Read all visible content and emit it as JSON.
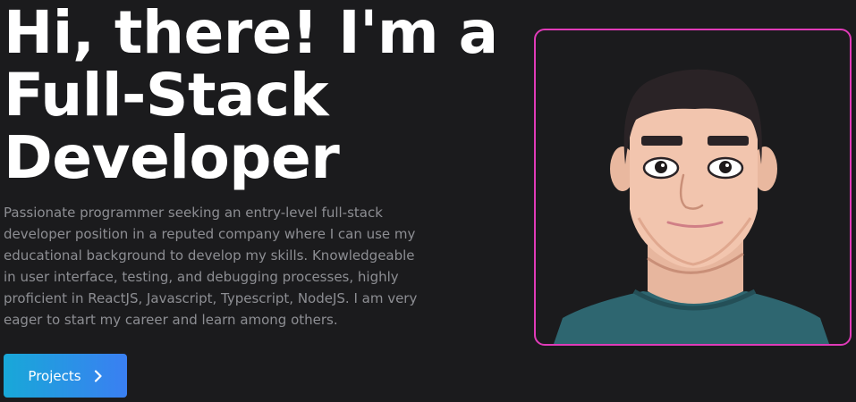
{
  "hero": {
    "headline_lines": [
      "Hi, there! I'm a",
      "Full-Stack",
      "Developer"
    ],
    "bio": "Passionate programmer seeking an entry-level full-stack developer position in a reputed company where I can use my educational background to develop my skills. Knowledgeable in user interface, testing, and debugging processes, highly proficient in ReactJS, Javascript, Typescript, NodeJS. I am very eager to start my career and learn among others."
  },
  "projects_button": {
    "label": "Projects",
    "icon": "chevron-right-icon"
  },
  "avatar": {
    "icon": "developer-avatar-illustration"
  },
  "colors": {
    "background": "#1b1b1d",
    "headline": "#ffffff",
    "bio_text": "#8d8e93",
    "button_gradient_start": "#18a8d8",
    "button_gradient_end": "#3a7ff2",
    "avatar_border": "#e03bb8"
  }
}
